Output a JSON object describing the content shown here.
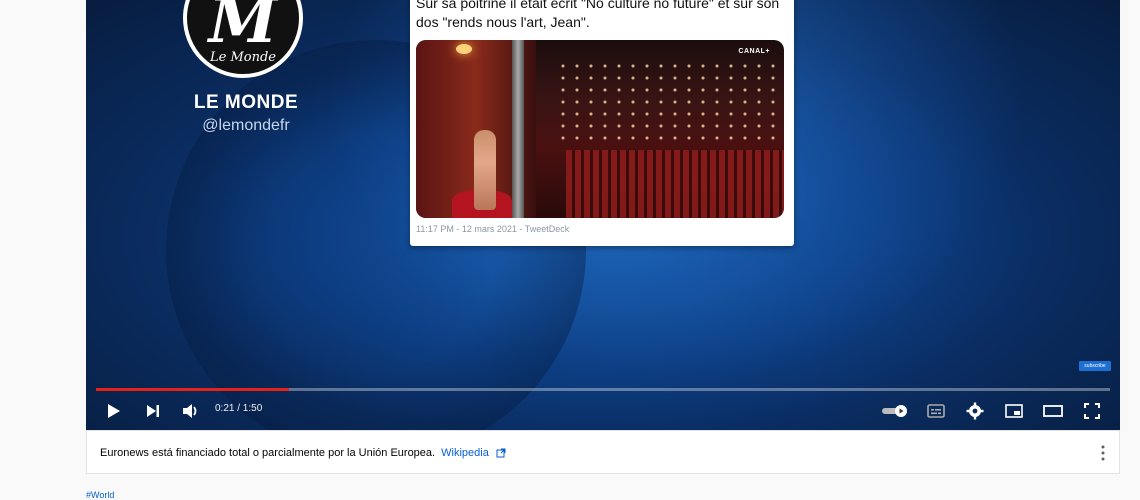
{
  "video": {
    "channel_name": "LE MONDE",
    "channel_handle": "@lemondefr",
    "logo_text": "Le Monde",
    "logo_letter": "M",
    "tweet": {
      "text": "Sur sa poitrine il était écrit \"No culture no future\" et sur son dos \"rends nous l'art, Jean\".",
      "media_badge": "CANAL+",
      "meta": "11:17 PM - 12 mars 2021 - TweetDeck"
    },
    "overlay_badge": "subscribe"
  },
  "player": {
    "time_display": "0:21 / 1:50",
    "progress": 0.19,
    "colors": {
      "progress": "#e62117",
      "background": "#0d3f85"
    }
  },
  "info_bar": {
    "text": "Euronews está financiado total o parcialmente por la Unión Europea.",
    "link_label": "Wikipedia"
  },
  "hashtag": "#World"
}
